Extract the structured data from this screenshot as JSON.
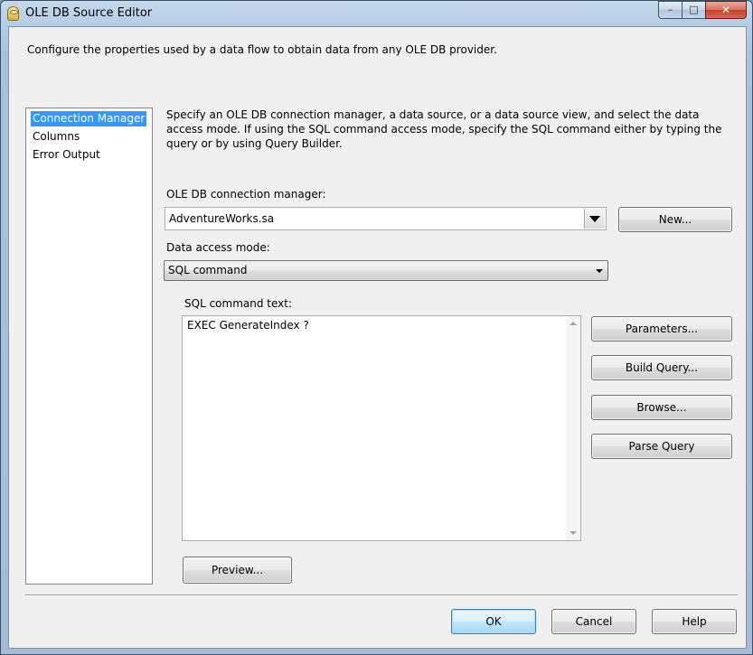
{
  "window": {
    "title": "OLE DB Source Editor",
    "controls": {
      "minimize": "–",
      "maximize": "□",
      "close": "✕"
    }
  },
  "header": {
    "description": "Configure the properties used by a data flow to obtain data from any OLE DB provider."
  },
  "sidebar": {
    "items": [
      {
        "label": "Connection Manager",
        "selected": true
      },
      {
        "label": "Columns",
        "selected": false
      },
      {
        "label": "Error Output",
        "selected": false
      }
    ]
  },
  "main": {
    "instructions": "Specify an OLE DB connection manager, a data source, or a data source view, and select the data access mode. If using the SQL command access mode, specify the SQL command either by typing the query or by using Query Builder.",
    "connection_label": "OLE DB connection manager:",
    "connection_value": "AdventureWorks.sa",
    "new_button": "New...",
    "access_mode_label": "Data access mode:",
    "access_mode_value": "SQL command",
    "sql_label": "SQL command text:",
    "sql_text": "EXEC GenerateIndex ?",
    "parameters_button": "Parameters...",
    "build_query_button": "Build Query...",
    "browse_button": "Browse...",
    "parse_query_button": "Parse Query",
    "preview_button": "Preview..."
  },
  "footer": {
    "ok": "OK",
    "cancel": "Cancel",
    "help": "Help"
  },
  "colors": {
    "selection": "#3399ff",
    "window_frame": "#b3cbe3",
    "close_button": "#c6412b",
    "dialog_bg": "#f0f0f0"
  }
}
